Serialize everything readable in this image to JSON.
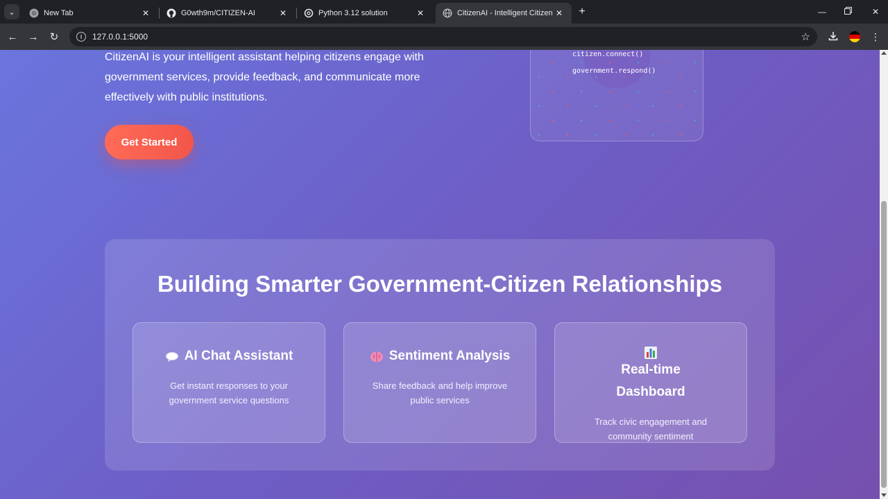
{
  "browser": {
    "tabs": [
      {
        "title": "New Tab",
        "icon": "chrome-icon",
        "active": false
      },
      {
        "title": "G0wth9m/CITIZEN-AI",
        "icon": "github-icon",
        "active": false
      },
      {
        "title": "Python 3.12 solution",
        "icon": "openai-icon",
        "active": false
      },
      {
        "title": "CitizenAI - Intelligent Citizen En",
        "icon": "globe-icon",
        "active": true
      }
    ],
    "url": "127.0.0.1:5000",
    "new_tab": "+",
    "close": "✕"
  },
  "hero": {
    "description": "CitizenAI is your intelligent assistant helping citizens engage with government services, provide feedback, and communicate more effectively with public institutions.",
    "cta_label": "Get Started",
    "code_lines": [
      "citizen.connect()",
      "government.respond()"
    ]
  },
  "features": {
    "title": "Building Smarter Government-Citizen Relationships",
    "cards": [
      {
        "title": "AI Chat Assistant",
        "icon": "speech-bubble-icon",
        "description": "Get instant responses to your government service questions"
      },
      {
        "title": "Sentiment Analysis",
        "icon": "brain-icon",
        "description": "Share feedback and help improve public services"
      },
      {
        "title": "Real-time Dashboard",
        "icon": "bar-chart-icon",
        "description": "Track civic engagement and community sentiment"
      }
    ]
  },
  "colors": {
    "gradient_start": "#6a75dd",
    "gradient_end": "#7650ae",
    "cta": "#f2564a"
  }
}
